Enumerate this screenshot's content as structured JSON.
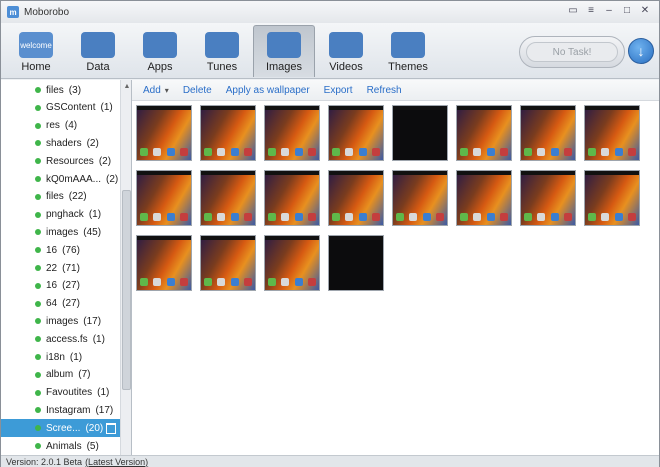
{
  "app": {
    "title": "Moborobo",
    "version": "Version: 2.0.1 Beta",
    "latest": "(Latest Version)"
  },
  "nav": [
    {
      "label": "Home",
      "icon": "home-icon",
      "color": "#5a8fcf",
      "glyph": "welcome"
    },
    {
      "label": "Data",
      "icon": "data-icon",
      "color": "#4a7fc1",
      "glyph": ""
    },
    {
      "label": "Apps",
      "icon": "apps-icon",
      "color": "#4a7fc1",
      "glyph": ""
    },
    {
      "label": "Tunes",
      "icon": "tunes-icon",
      "color": "#4a7fc1",
      "glyph": ""
    },
    {
      "label": "Images",
      "icon": "images-icon",
      "color": "#4a7fc1",
      "glyph": ""
    },
    {
      "label": "Videos",
      "icon": "videos-icon",
      "color": "#4a7fc1",
      "glyph": ""
    },
    {
      "label": "Themes",
      "icon": "themes-icon",
      "color": "#4a7fc1",
      "glyph": ""
    }
  ],
  "task": {
    "label": "No Task!"
  },
  "actions": [
    "Add",
    "Delete",
    "Apply as wallpaper",
    "Export",
    "Refresh"
  ],
  "folders": [
    {
      "label": "files",
      "count": "(3)"
    },
    {
      "label": "GSContent",
      "count": "(1)"
    },
    {
      "label": "res",
      "count": "(4)"
    },
    {
      "label": "shaders",
      "count": "(2)"
    },
    {
      "label": "Resources",
      "count": "(2)"
    },
    {
      "label": "kQ0mAAA...",
      "count": "(2)"
    },
    {
      "label": "files",
      "count": "(22)"
    },
    {
      "label": "pnghack",
      "count": "(1)"
    },
    {
      "label": "images",
      "count": "(45)"
    },
    {
      "label": "16",
      "count": "(76)"
    },
    {
      "label": "22",
      "count": "(71)"
    },
    {
      "label": "16",
      "count": "(27)"
    },
    {
      "label": "64",
      "count": "(27)"
    },
    {
      "label": "images",
      "count": "(17)"
    },
    {
      "label": "access.fs",
      "count": "(1)"
    },
    {
      "label": "i18n",
      "count": "(1)"
    },
    {
      "label": "album",
      "count": "(7)"
    },
    {
      "label": "Favoutites",
      "count": "(1)"
    },
    {
      "label": "Instagram",
      "count": "(17)"
    },
    {
      "label": "Scree...",
      "count": "(20)"
    },
    {
      "label": "Animals",
      "count": "(5)"
    }
  ],
  "selected_folder_index": 19,
  "thumbnails": [
    "wall",
    "wall",
    "wall",
    "wall",
    "dark",
    "wall",
    "wall",
    "wall",
    "wall",
    "wall",
    "wall",
    "wall",
    "wall",
    "wall",
    "wall",
    "wall",
    "wall",
    "wall",
    "wall",
    "dark"
  ]
}
